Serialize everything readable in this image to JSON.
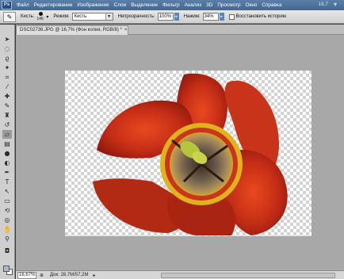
{
  "menubar": {
    "logo": "Ps",
    "items": [
      "Файл",
      "Редактирование",
      "Изображение",
      "Слои",
      "Выделение",
      "Фильтр",
      "Анализ",
      "3D",
      "Просмотр",
      "Окно",
      "Справка"
    ],
    "zoom": "16,7"
  },
  "options": {
    "brush_label": "Кисть:",
    "brush_size": "146",
    "mode_label": "Режим:",
    "mode_value": "Кисть",
    "opacity_label": "Непрозрачность:",
    "opacity_value": "100%",
    "pressure_label": "Нажим:",
    "pressure_value": "34%",
    "history_label": "Восстановить историю"
  },
  "document": {
    "tab_title": "DSC02736.JPG @ 16,7% (Фон копия, RGB/8) *",
    "close": "×"
  },
  "status": {
    "zoom": "16,67%",
    "doc_info": "Док: 28,7M/57,2M"
  },
  "colors": {
    "menubar": "#4f739d",
    "panel": "#cfcfcf",
    "pasteboard": "#a8a8a8",
    "petal_red": "#c7321b",
    "center_yellow": "#e2b21a",
    "stigma": "#b5c43a"
  },
  "tools": [
    "move-icon",
    "marquee-icon",
    "lasso-icon",
    "quick-select-icon",
    "crop-icon",
    "eyedropper-icon",
    "healing-icon",
    "brush-icon",
    "clone-stamp-icon",
    "history-brush-icon",
    "eraser-icon",
    "gradient-icon",
    "blur-icon",
    "dodge-icon",
    "pen-icon",
    "type-icon",
    "path-select-icon",
    "shape-icon",
    "3d-rotate-icon",
    "3d-orbit-icon",
    "hand-icon",
    "zoom-icon",
    "quick-mask-icon"
  ]
}
